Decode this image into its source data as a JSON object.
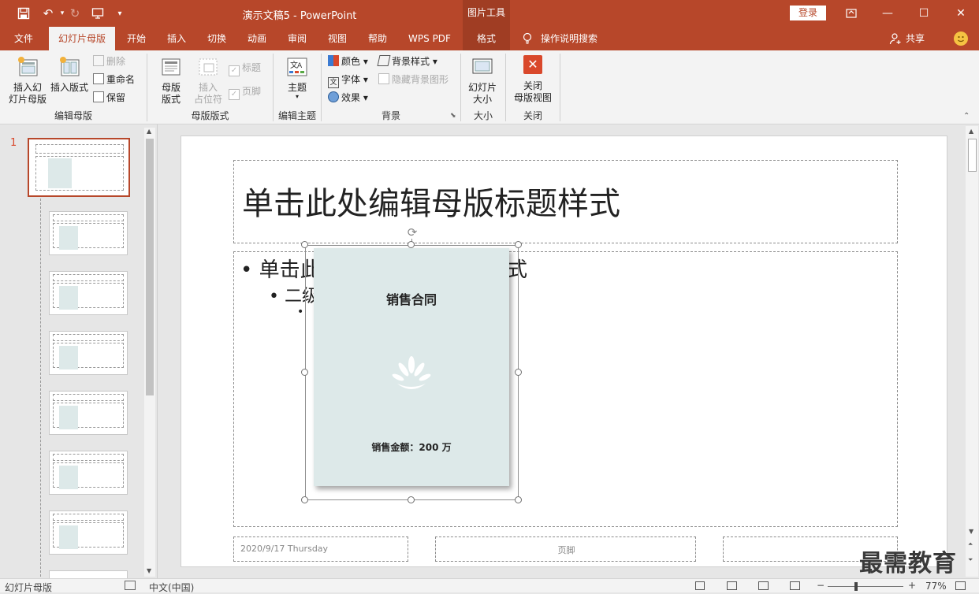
{
  "titlebar": {
    "title": "演示文稿5  -  PowerPoint",
    "context_group": "图片工具",
    "login": "登录"
  },
  "tabs": [
    "文件",
    "幻灯片母版",
    "开始",
    "插入",
    "切换",
    "动画",
    "审阅",
    "视图",
    "帮助",
    "WPS PDF",
    "格式"
  ],
  "active_tab": "幻灯片母版",
  "tell_me": "操作说明搜索",
  "share": "共享",
  "ribbon": {
    "groups": {
      "edit_master": "编辑母版",
      "master_layout": "母版版式",
      "edit_theme": "编辑主题",
      "background": "背景",
      "size": "大小",
      "close": "关闭"
    },
    "insert_slide_master": "插入幻\n灯片母版",
    "insert_layout": "插入版式",
    "delete": "删除",
    "rename": "重命名",
    "preserve": "保留",
    "master_layout_btn": "母版\n版式",
    "insert_placeholder": "插入\n占位符",
    "title_chk": "标题",
    "footer_chk": "页脚",
    "themes": "主题",
    "colors": "颜色",
    "fonts": "字体",
    "effects": "效果",
    "bg_styles": "背景样式",
    "hide_bg": "隐藏背景图形",
    "slide_size": "幻灯片\n大小",
    "close_master": "关闭\n母版视图"
  },
  "thumbs": {
    "slide_number": "1"
  },
  "slide": {
    "title_text": "单击此处编辑母版标题样式",
    "bullet1": "单击此",
    "bullet1_tail": "式",
    "bullet2": "二级",
    "date": "2020/9/17 Thursday",
    "footer": "页脚",
    "picture_title": "销售合同",
    "picture_amount": "销售金额：200 万"
  },
  "status": {
    "view": "幻灯片母版",
    "language": "中文(中国)",
    "zoom": "77%"
  },
  "watermark": "最需教育",
  "colors": {
    "accent": "#b7472a",
    "picture_bg": "#dde9e9"
  }
}
